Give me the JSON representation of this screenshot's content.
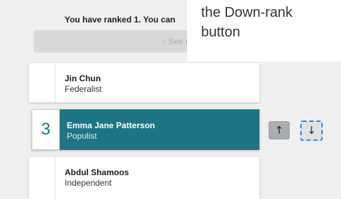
{
  "status_text": "You have ranked 1. You can",
  "see_more_label": "↑ See m",
  "callout_text": "the Down-rank button",
  "candidates": [
    {
      "rank": "",
      "name": "Jin Chun",
      "party": "Federalist"
    },
    {
      "rank": "3",
      "name": "Emma Jane Patterson",
      "party": "Populist"
    },
    {
      "rank": "",
      "name": "Abdul Shamoos",
      "party": "Independent"
    }
  ],
  "buttons": {
    "up_icon": "↑",
    "down_icon": "↓"
  },
  "colors": {
    "selected_bg": "#1e7585",
    "focus_ring": "#3a7fe0"
  }
}
